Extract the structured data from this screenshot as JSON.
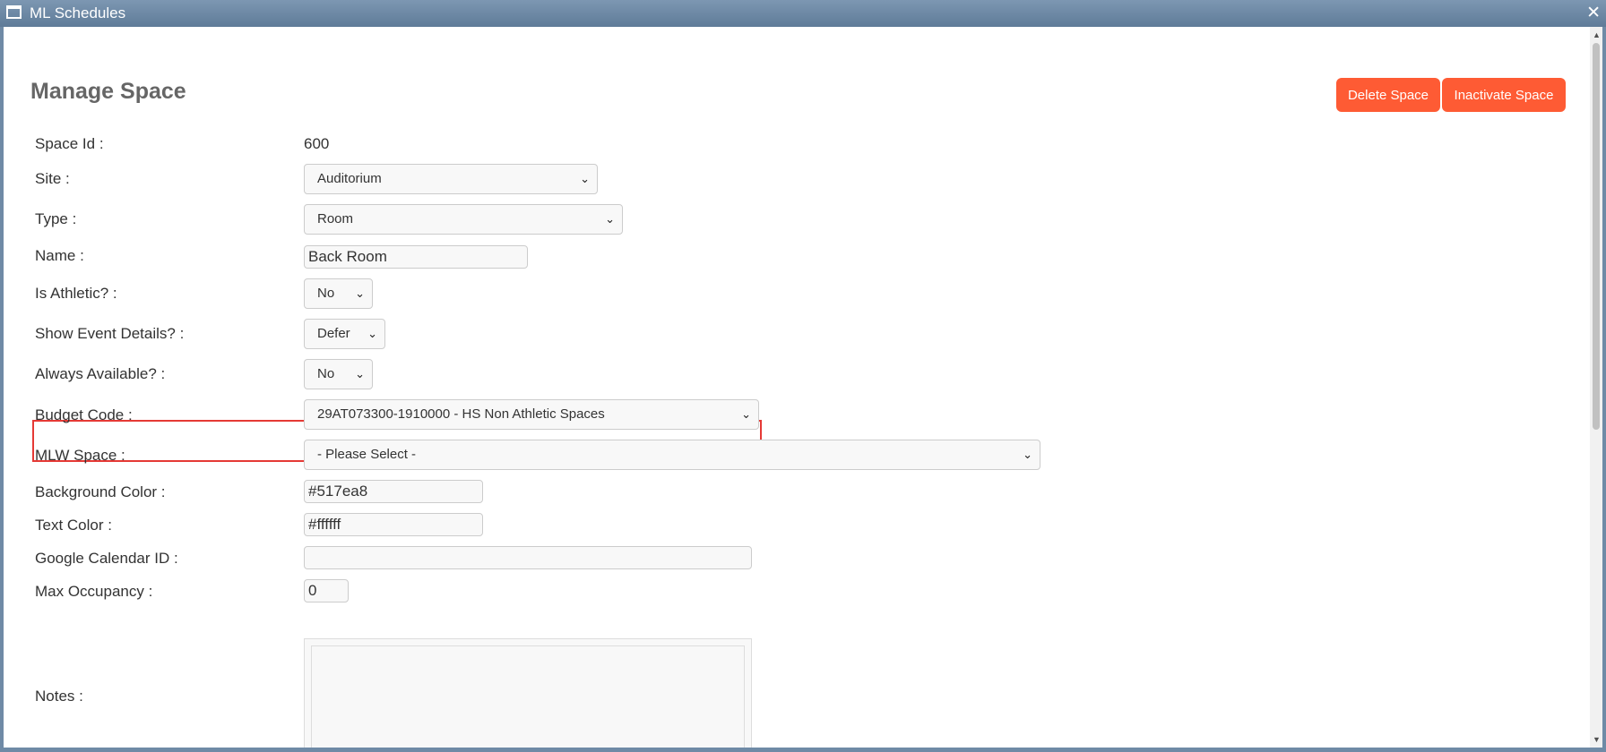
{
  "window": {
    "title": "ML Schedules",
    "close_label": "✕"
  },
  "page": {
    "title": "Manage Space"
  },
  "actions": {
    "delete_label": "Delete Space",
    "inactivate_label": "Inactivate Space"
  },
  "form": {
    "space_id": {
      "label": "Space Id :",
      "value": "600"
    },
    "site": {
      "label": "Site :",
      "value": "Auditorium"
    },
    "type": {
      "label": "Type :",
      "value": "Room"
    },
    "name": {
      "label": "Name :",
      "value": "Back Room"
    },
    "is_athletic": {
      "label": "Is Athletic? :",
      "value": "No"
    },
    "show_event_details": {
      "label": "Show Event Details? :",
      "value": "Defer"
    },
    "always_available": {
      "label": "Always Available? :",
      "value": "No"
    },
    "budget_code": {
      "label": "Budget Code :",
      "value": "29AT073300-1910000 - HS Non Athletic Spaces"
    },
    "mlw_space": {
      "label": "MLW Space :",
      "value": "- Please Select -"
    },
    "background_color": {
      "label": "Background Color :",
      "value": "#517ea8"
    },
    "text_color": {
      "label": "Text Color :",
      "value": "#ffffff"
    },
    "google_calendar_id": {
      "label": "Google Calendar ID :",
      "value": ""
    },
    "max_occupancy": {
      "label": "Max Occupancy :",
      "value": "0"
    },
    "notes": {
      "label": "Notes :",
      "value": ""
    }
  },
  "colors": {
    "accent": "#fe5b34",
    "titlebar": "#6f8aa6",
    "highlight": "#e53935"
  }
}
